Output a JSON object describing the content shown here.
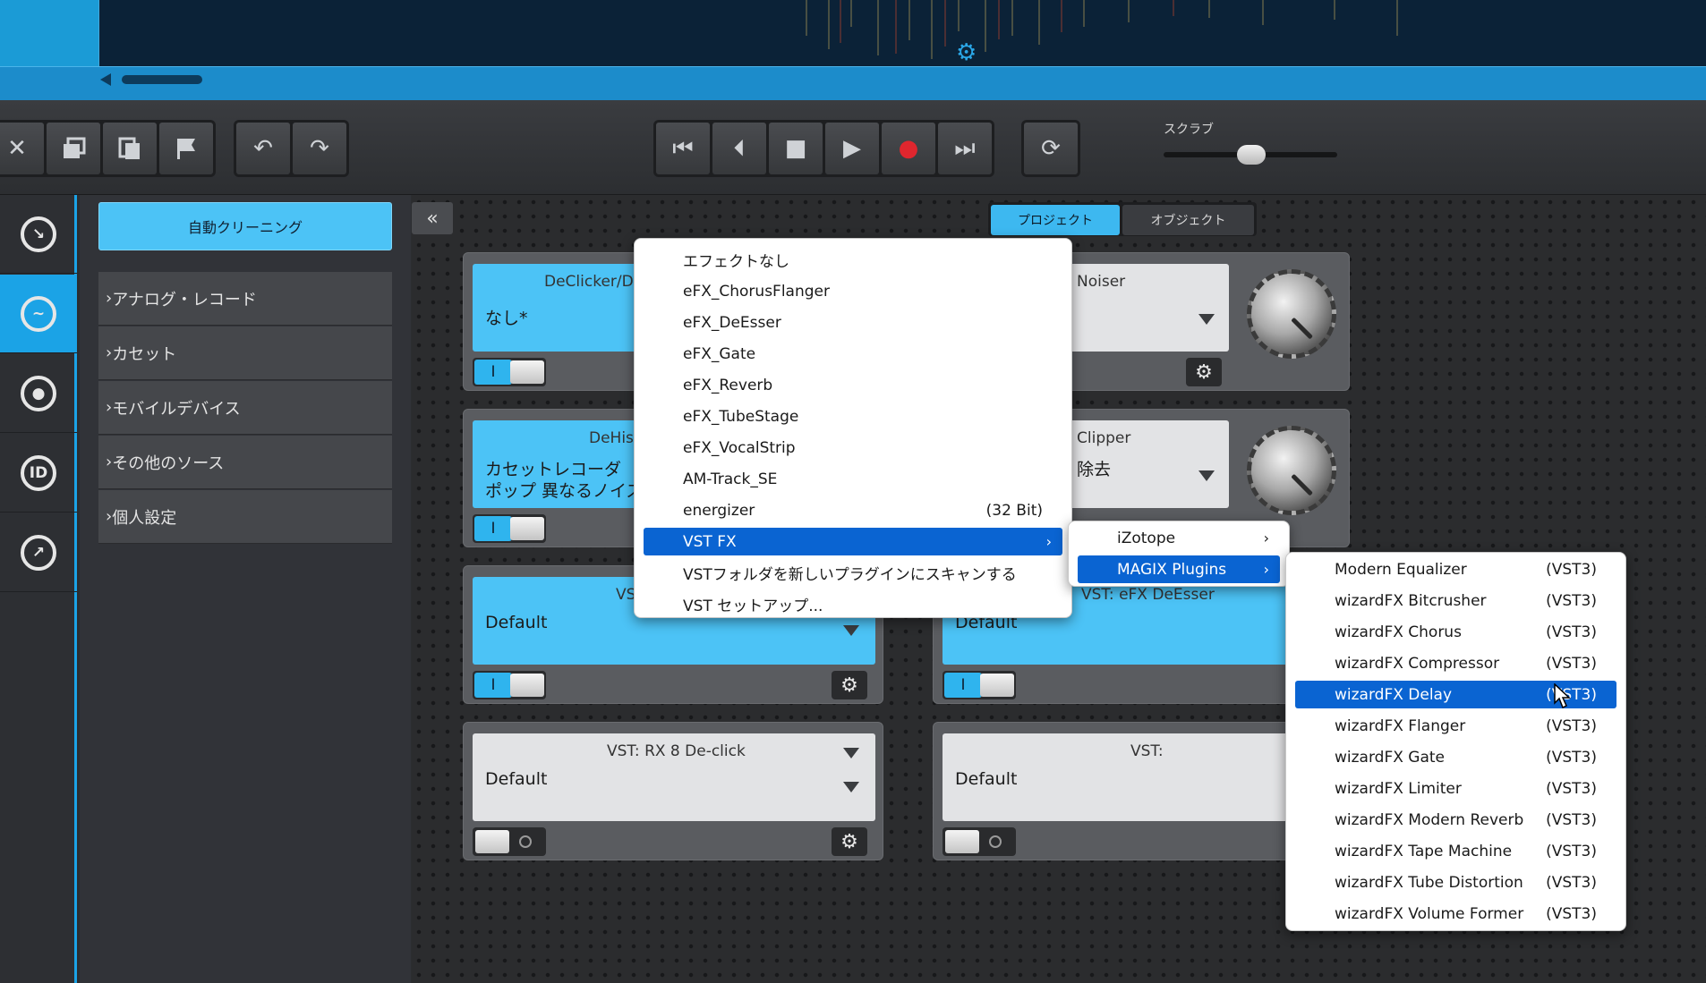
{
  "toolbar": {
    "scrub_label": "スクラブ",
    "buttons": [
      "close-icon",
      "stack-icon",
      "copy-icon",
      "flag-icon",
      "undo-icon",
      "redo-icon"
    ],
    "transport": [
      "skip-start-icon",
      "prev-marker-icon",
      "stop-icon",
      "play-icon",
      "record-icon",
      "next-marker-icon"
    ],
    "loop_icon": "loop-icon"
  },
  "nav_rail": {
    "items": [
      "import-icon",
      "cleaning-icon",
      "disc-icon",
      "id-tag-icon",
      "export-icon"
    ],
    "nav_id_label": "ID"
  },
  "presets": {
    "auto_clean": "自動クリーニング",
    "items": [
      "アナログ・レコード",
      "カセット",
      "モバイルデバイス",
      "その他のソース",
      "個人設定"
    ]
  },
  "tabs": {
    "collapse": "«",
    "project": "プロジェクト",
    "object": "オブジェクト"
  },
  "effects": {
    "card1": {
      "title": "DeClicker/De",
      "value": "なし*",
      "toggle": "I"
    },
    "card2": {
      "title": "DeHiss",
      "value_line1": "カセットレコーダ",
      "value_line2": "ポップ 異なるノイズレ",
      "toggle": "I"
    },
    "card3": {
      "title": "VST",
      "value": "Default",
      "toggle": "I"
    },
    "card4": {
      "title": "VST: RX 8 De-click",
      "value": "Default"
    },
    "card5": {
      "title": "Noiser"
    },
    "card6": {
      "title": "Clipper",
      "value": "除去"
    },
    "card7": {
      "title": "VST: eFX DeEsser",
      "value": "Default",
      "toggle": "I"
    },
    "card8": {
      "title": "VST:",
      "value": "Default"
    }
  },
  "menu_main": {
    "items": [
      {
        "label": "エフェクトなし"
      },
      {
        "label": "eFX_ChorusFlanger"
      },
      {
        "label": "eFX_DeEsser"
      },
      {
        "label": "eFX_Gate"
      },
      {
        "label": "eFX_Reverb"
      },
      {
        "label": "eFX_TubeStage"
      },
      {
        "label": "eFX_VocalStrip"
      },
      {
        "label": "AM-Track_SE"
      },
      {
        "label": "energizer",
        "suffix": "(32 Bit)"
      },
      {
        "label": "VST FX",
        "arrow": "›",
        "highlighted": true
      },
      {
        "label": "VSTフォルダを新しいプラグインにスキャンする"
      },
      {
        "label": "VST セットアップ..."
      }
    ]
  },
  "menu_vst": {
    "items": [
      {
        "label": "iZotope",
        "arrow": "›"
      },
      {
        "label": "MAGIX Plugins",
        "arrow": "›",
        "highlighted": true
      }
    ]
  },
  "menu_magix": {
    "items": [
      {
        "label": "Modern Equalizer",
        "suffix": "(VST3)"
      },
      {
        "label": "wizardFX Bitcrusher",
        "suffix": "(VST3)"
      },
      {
        "label": "wizardFX Chorus",
        "suffix": "(VST3)"
      },
      {
        "label": "wizardFX Compressor",
        "suffix": "(VST3)"
      },
      {
        "label": "wizardFX Delay",
        "suffix": "(VST3)",
        "highlighted": true
      },
      {
        "label": "wizardFX Flanger",
        "suffix": "(VST3)"
      },
      {
        "label": "wizardFX Gate",
        "suffix": "(VST3)"
      },
      {
        "label": "wizardFX Limiter",
        "suffix": "(VST3)"
      },
      {
        "label": "wizardFX Modern Reverb",
        "suffix": "(VST3)"
      },
      {
        "label": "wizardFX Tape Machine",
        "suffix": "(VST3)"
      },
      {
        "label": "wizardFX Tube Distortion",
        "suffix": "(VST3)"
      },
      {
        "label": "wizardFX Volume Former",
        "suffix": "(VST3)"
      }
    ]
  },
  "colors": {
    "accent": "#1ba3e6",
    "screen_blue": "#4cc3f6",
    "menu_highlight": "#0a64d2",
    "record": "#e0262e"
  }
}
